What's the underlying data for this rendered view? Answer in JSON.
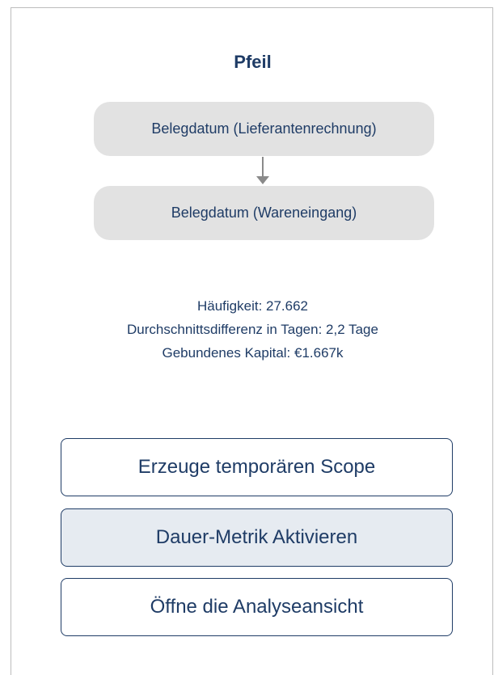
{
  "panel": {
    "title": "Pfeil"
  },
  "flow": {
    "source_label": "Belegdatum (Lieferantenrechnung)",
    "target_label": "Belegdatum (Wareneingang)"
  },
  "stats": {
    "frequency": "Häufigkeit: 27.662",
    "avg_difference": "Durchschnittsdifferenz in Tagen: 2,2 Tage",
    "bound_capital": "Gebundenes Kapital: €1.667k"
  },
  "actions": {
    "create_scope": "Erzeuge temporären Scope",
    "activate_duration": "Dauer-Metrik Aktivieren",
    "open_analysis": "Öffne die Analyseansicht"
  },
  "colors": {
    "text": "#1f3c66",
    "node_fill": "#e2e2e2",
    "arrow": "#8a8a8a",
    "highlight_button": "#e6ebf1"
  }
}
